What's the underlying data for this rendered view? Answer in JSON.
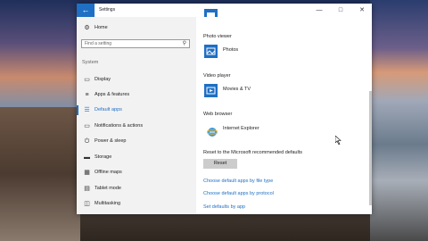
{
  "window": {
    "title": "Settings",
    "back_icon": "arrow-left-icon",
    "controls": [
      "minimize-icon",
      "maximize-icon",
      "close-icon"
    ]
  },
  "sidebar": {
    "home_label": "Home",
    "search_placeholder": "Find a setting",
    "section_label": "System",
    "items": [
      {
        "label": "Display",
        "icon": "monitor-icon"
      },
      {
        "label": "Apps & features",
        "icon": "list-icon"
      },
      {
        "label": "Default apps",
        "icon": "default-apps-icon",
        "active": true
      },
      {
        "label": "Notifications & actions",
        "icon": "notification-icon"
      },
      {
        "label": "Power & sleep",
        "icon": "power-icon"
      },
      {
        "label": "Storage",
        "icon": "storage-icon"
      },
      {
        "label": "Offline maps",
        "icon": "map-icon"
      },
      {
        "label": "Tablet mode",
        "icon": "tablet-icon"
      },
      {
        "label": "Multitasking",
        "icon": "multitasking-icon"
      }
    ]
  },
  "content": {
    "photo_viewer": {
      "heading": "Photo viewer",
      "app": "Photos"
    },
    "video_player": {
      "heading": "Video player",
      "app": "Movies & TV"
    },
    "web_browser": {
      "heading": "Web browser",
      "app": "Internet Explorer"
    },
    "reset": {
      "label": "Reset to the Microsoft recommended defaults",
      "button": "Reset"
    },
    "links": [
      "Choose default apps by file type",
      "Choose default apps by protocol",
      "Set defaults by app"
    ]
  },
  "colors": {
    "accent": "#1f6fc4",
    "sidebar_bg": "#f2f2f2",
    "button_bg": "#cccccc"
  }
}
